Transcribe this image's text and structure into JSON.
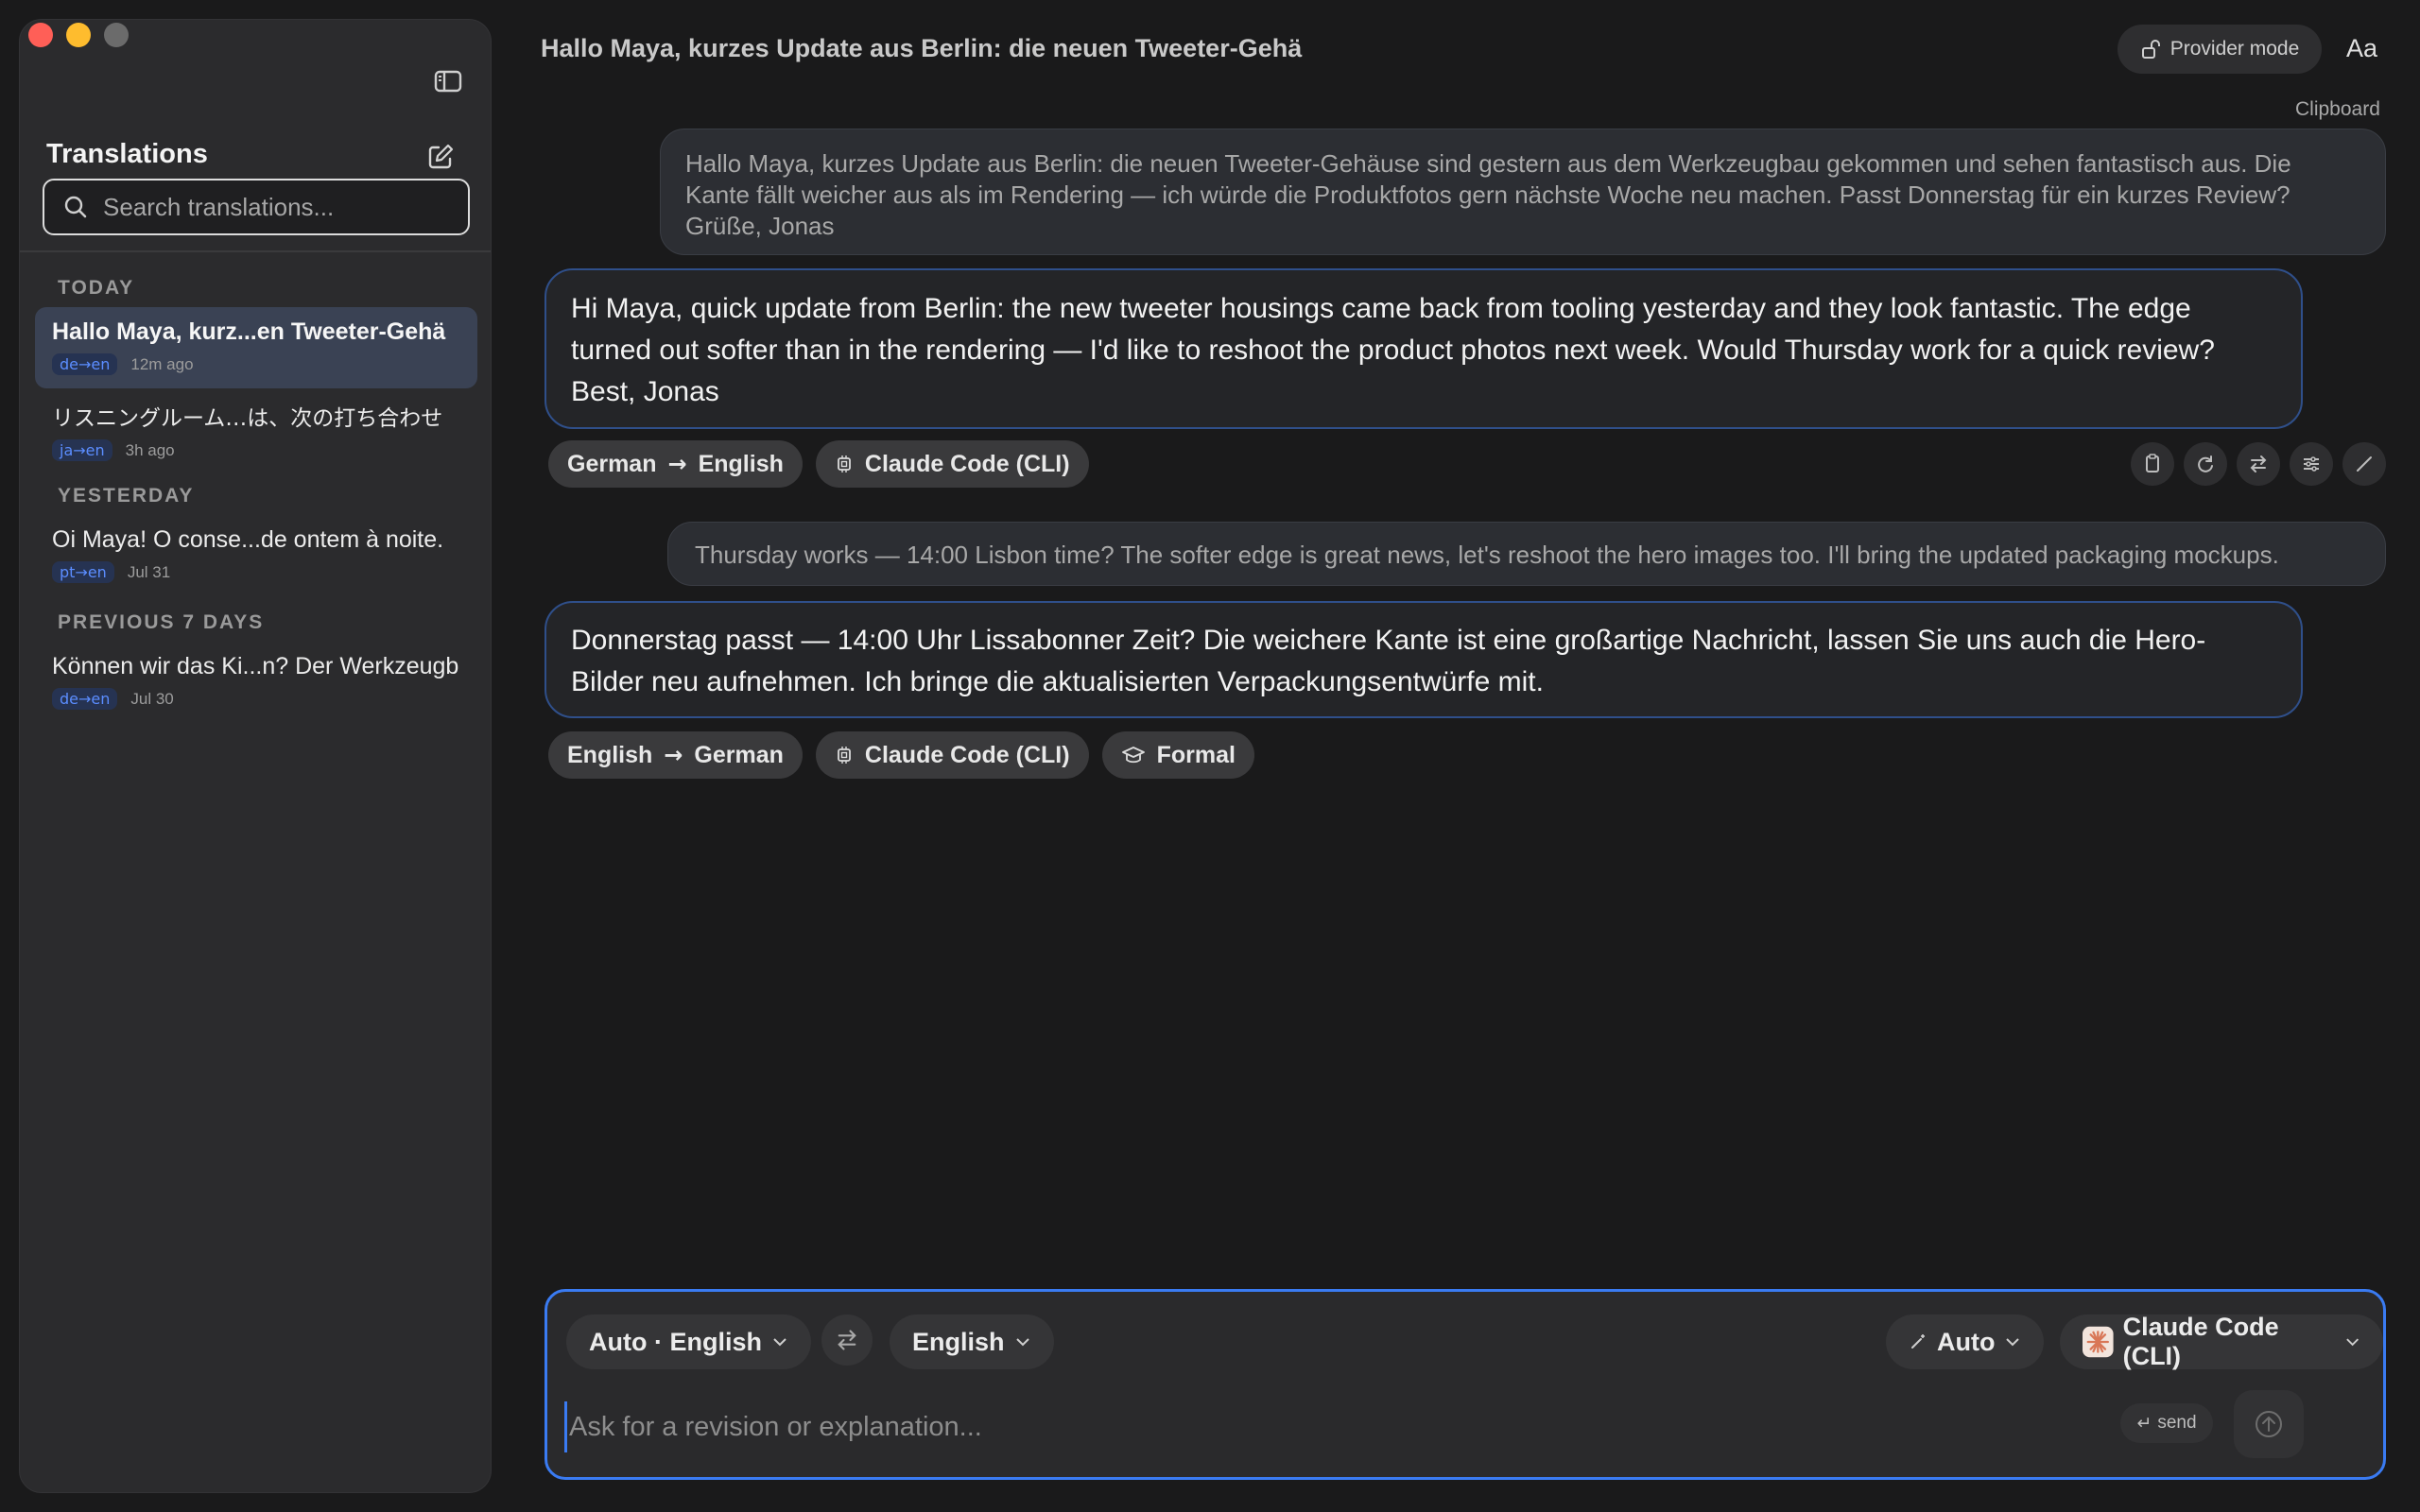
{
  "sidebar": {
    "title": "Translations",
    "search_placeholder": "Search translations...",
    "sections": [
      {
        "label": "TODAY",
        "items": [
          {
            "title": "Hallo Maya, kurz...en Tweeter-Gehä",
            "lang": "de→en",
            "time": "12m ago",
            "active": true
          },
          {
            "title": "リスニングルーム…は、次の打ち合わせ",
            "lang": "ja→en",
            "time": "3h ago",
            "active": false
          }
        ]
      },
      {
        "label": "YESTERDAY",
        "items": [
          {
            "title": "Oi Maya! O conse...de ontem à noite.",
            "lang": "pt→en",
            "time": "Jul 31",
            "active": false
          }
        ]
      },
      {
        "label": "PREVIOUS 7 DAYS",
        "items": [
          {
            "title": "Können wir das Ki...n? Der Werkzeugb",
            "lang": "de→en",
            "time": "Jul 30",
            "active": false
          }
        ]
      }
    ]
  },
  "header": {
    "title": "Hallo Maya, kurzes Update aus Berlin: die neuen Tweeter-Gehä",
    "provider_mode_label": "Provider mode",
    "font_button_label": "Aa"
  },
  "conversation": {
    "clipboard_label": "Clipboard",
    "turns": [
      {
        "source": "Hallo Maya, kurzes Update aus Berlin: die neuen Tweeter-Gehäuse sind gestern aus dem Werkzeugbau gekommen und sehen fantastisch aus. Die Kante fällt weicher aus als im Rendering — ich würde die Produktfotos gern nächste Woche neu machen. Passt Donnerstag für ein kurzes Review? Grüße, Jonas",
        "translation": "Hi Maya, quick update from Berlin: the new tweeter housings came back from tooling yesterday and they look fantastic. The edge turned out softer than in the rendering — I'd like to reshoot the product photos next week. Would Thursday work for a quick review? Best, Jonas",
        "from_lang": "German",
        "to_lang": "English",
        "arrow": "→",
        "provider": "Claude Code (CLI)"
      },
      {
        "source": "Thursday works — 14:00 Lisbon time? The softer edge is great news, let's reshoot the hero images too. I'll bring the updated packaging mockups.",
        "translation": "Donnerstag passt — 14:00 Uhr Lissabonner Zeit? Die weichere Kante ist eine großartige Nachricht, lassen Sie uns auch die Hero-Bilder neu aufnehmen. Ich bringe die aktualisierten Verpackungsentwürfe mit.",
        "from_lang": "English",
        "to_lang": "German",
        "arrow": "→",
        "provider": "Claude Code (CLI)",
        "tone": "Formal"
      }
    ]
  },
  "composer": {
    "source_lang": "Auto · English",
    "target_lang": "English",
    "mode": "Auto",
    "provider": "Claude Code (CLI)",
    "placeholder": "Ask for a revision or explanation...",
    "send_hint": "send",
    "send_hint_icon": "↵"
  },
  "colors": {
    "accent": "#3a7bf2",
    "close": "#ff5f57",
    "minimize": "#febc2e",
    "lang_pill": "#5b8dff",
    "provider_logo": "#d97757"
  }
}
